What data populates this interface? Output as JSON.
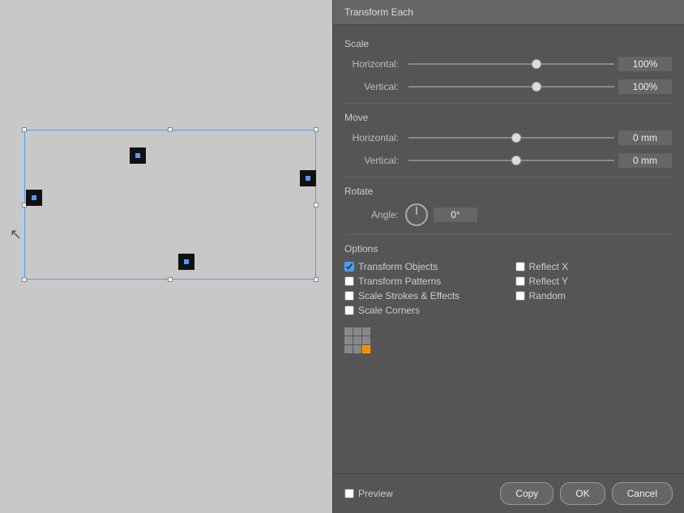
{
  "window": {
    "title": "Transform Each"
  },
  "canvas": {
    "background": "#c8c8c8"
  },
  "panel": {
    "title": "Transform Each",
    "sections": {
      "scale": {
        "label": "Scale",
        "horizontal": {
          "label": "Horizontal:",
          "value": "100%",
          "slider_pos": "60"
        },
        "vertical": {
          "label": "Vertical:",
          "value": "100%",
          "slider_pos": "60"
        }
      },
      "move": {
        "label": "Move",
        "horizontal": {
          "label": "Horizontal:",
          "value": "0 mm",
          "slider_pos": "50"
        },
        "vertical": {
          "label": "Vertical:",
          "value": "0 mm",
          "slider_pos": "50"
        }
      },
      "rotate": {
        "label": "Rotate",
        "angle_label": "Angle:",
        "angle_value": "0°"
      },
      "options": {
        "label": "Options",
        "checkboxes": [
          {
            "id": "transform-objects",
            "label": "Transform Objects",
            "checked": true,
            "col": 1
          },
          {
            "id": "transform-patterns",
            "label": "Transform Patterns",
            "checked": false,
            "col": 1
          },
          {
            "id": "scale-strokes",
            "label": "Scale Strokes & Effects",
            "checked": false,
            "col": 1
          },
          {
            "id": "scale-corners",
            "label": "Scale Corners",
            "checked": false,
            "col": 1
          },
          {
            "id": "reflect-x",
            "label": "Reflect X",
            "checked": false,
            "col": 2
          },
          {
            "id": "reflect-y",
            "label": "Reflect Y",
            "checked": false,
            "col": 2
          },
          {
            "id": "random",
            "label": "Random",
            "checked": false,
            "col": 2
          }
        ]
      }
    },
    "footer": {
      "preview_label": "Preview",
      "copy_label": "Copy",
      "ok_label": "OK",
      "cancel_label": "Cancel"
    }
  }
}
